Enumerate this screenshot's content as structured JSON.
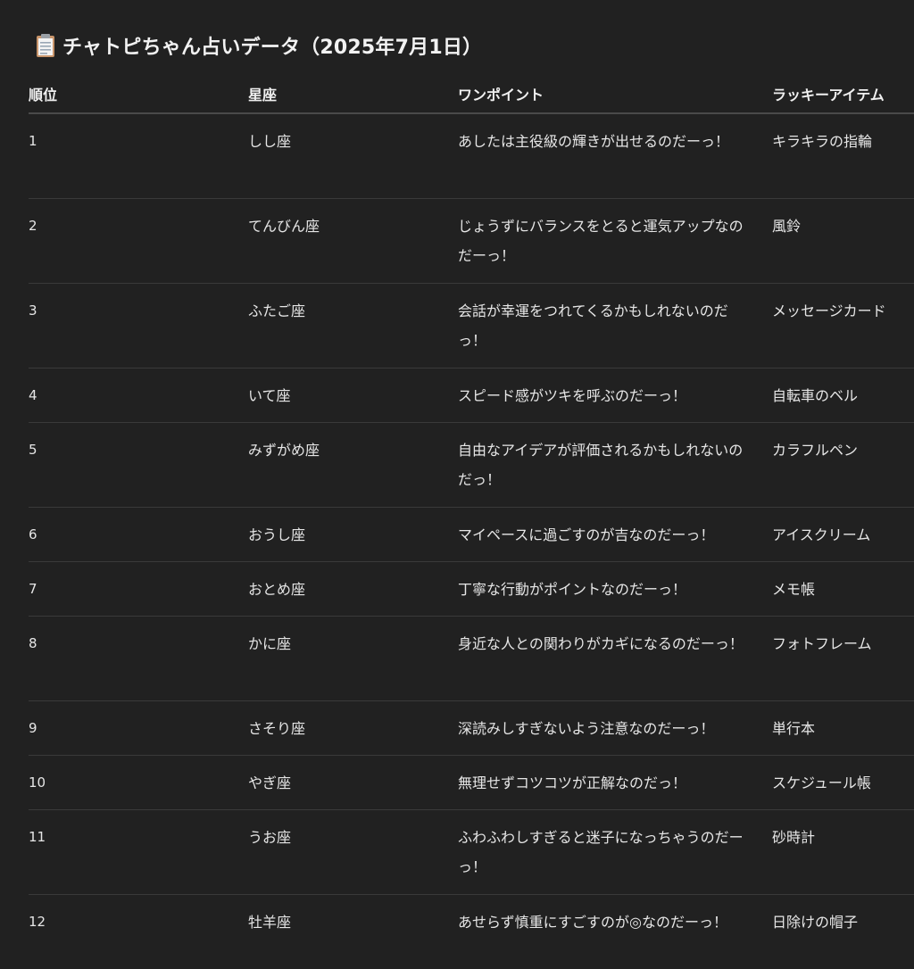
{
  "title": {
    "icon": "clipboard-icon",
    "text": "チャトピちゃん占いデータ（2025年7月1日）"
  },
  "table": {
    "headers": [
      "順位",
      "星座",
      "ワンポイント",
      "ラッキーアイテム"
    ],
    "rows": [
      {
        "rank": "1",
        "sign": "しし座",
        "point": "あしたは主役級の輝きが出せるのだーっ！",
        "item": "キラキラの指輪"
      },
      {
        "rank": "2",
        "sign": "てんびん座",
        "point": "じょうずにバランスをとると運気アップなのだーっ！",
        "item": "風鈴"
      },
      {
        "rank": "3",
        "sign": "ふたご座",
        "point": "会話が幸運をつれてくるかもしれないのだっ！",
        "item": "メッセージカード"
      },
      {
        "rank": "4",
        "sign": "いて座",
        "point": "スピード感がツキを呼ぶのだーっ！",
        "item": "自転車のベル"
      },
      {
        "rank": "5",
        "sign": "みずがめ座",
        "point": "自由なアイデアが評価されるかもしれないのだっ！",
        "item": "カラフルペン"
      },
      {
        "rank": "6",
        "sign": "おうし座",
        "point": "マイペースに過ごすのが吉なのだーっ！",
        "item": "アイスクリーム"
      },
      {
        "rank": "7",
        "sign": "おとめ座",
        "point": "丁寧な行動がポイントなのだーっ！",
        "item": "メモ帳"
      },
      {
        "rank": "8",
        "sign": "かに座",
        "point": "身近な人との関わりがカギになるのだーっ！",
        "item": "フォトフレーム"
      },
      {
        "rank": "9",
        "sign": "さそり座",
        "point": "深読みしすぎないよう注意なのだーっ！",
        "item": "単行本"
      },
      {
        "rank": "10",
        "sign": "やぎ座",
        "point": "無理せずコツコツが正解なのだっ！",
        "item": "スケジュール帳"
      },
      {
        "rank": "11",
        "sign": "うお座",
        "point": "ふわふわしすぎると迷子になっちゃうのだーっ！",
        "item": "砂時計"
      },
      {
        "rank": "12",
        "sign": "牡羊座",
        "point": "あせらず慎重にすごすのが◎なのだーっ！",
        "item": "日除けの帽子"
      }
    ]
  }
}
